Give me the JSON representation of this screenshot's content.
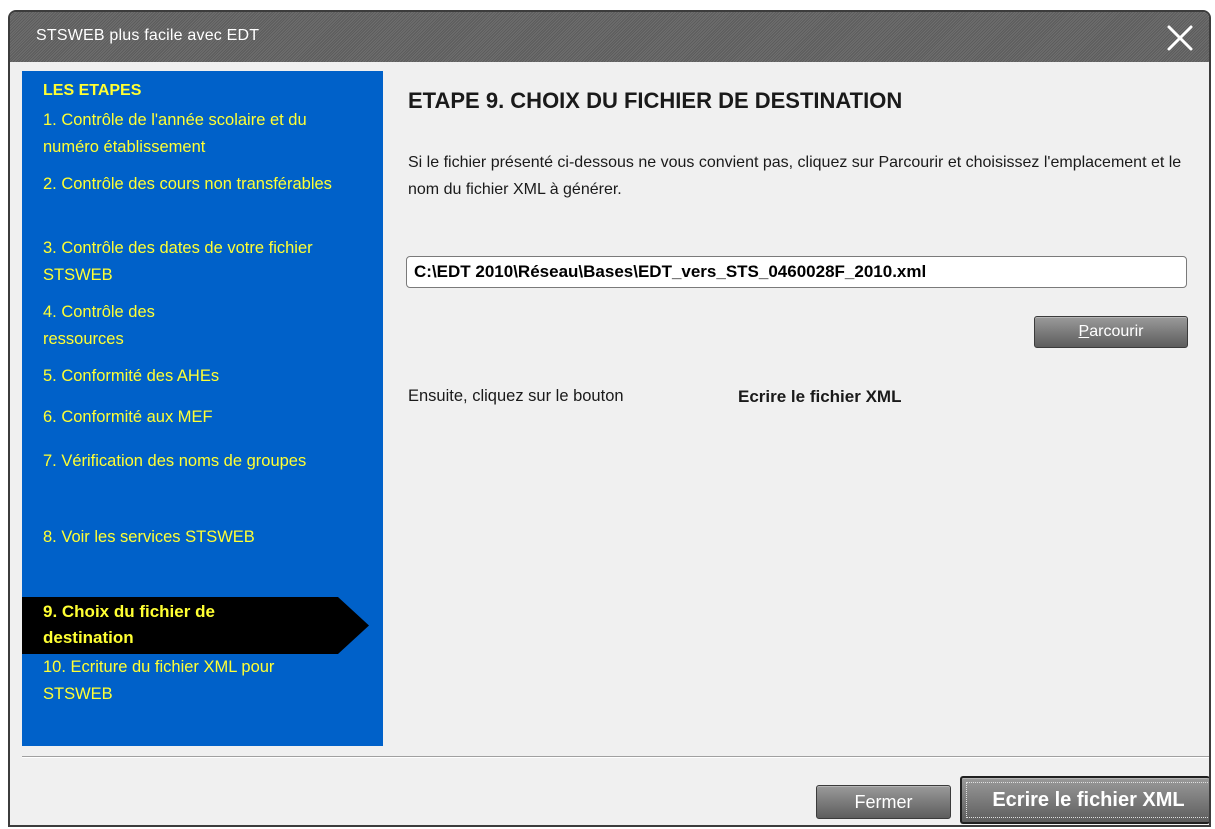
{
  "window": {
    "title": "STSWEB plus facile avec EDT"
  },
  "sidebar": {
    "header": "LES ETAPES",
    "steps": [
      {
        "label": "1. Contrôle de l'année scolaire et du numéro établissement"
      },
      {
        "label": "2. Contrôle des cours non transférables"
      },
      {
        "label": "3. Contrôle des dates de votre fichier STSWEB"
      },
      {
        "label": "4. Contrôle des ressources"
      },
      {
        "label": "5. Conformité des AHEs"
      },
      {
        "label": "6. Conformité aux MEF"
      },
      {
        "label": "7. Vérification des noms de groupes"
      },
      {
        "label": "8. Voir les services STSWEB"
      },
      {
        "label": "9. Choix du fichier  de destination",
        "active": true
      },
      {
        "label": "10. Ecriture du fichier XML pour STSWEB"
      }
    ]
  },
  "main": {
    "title": "ETAPE 9. CHOIX DU FICHIER DE DESTINATION",
    "instruction": "Si le fichier présenté ci-dessous ne vous convient pas, cliquez sur Parcourir et choisissez l'emplacement et le nom du fichier XML à générer.",
    "file_path": "C:\\EDT 2010\\Réseau\\Bases\\EDT_vers_STS_0460028F_2010.xml",
    "browse_mnemonic": "P",
    "browse_rest": "arcourir",
    "next_label": "Ensuite, cliquez sur le bouton",
    "next_action": "Ecrire le fichier XML"
  },
  "footer": {
    "close_label": "Fermer",
    "write_label": "Ecrire le fichier XML"
  },
  "colors": {
    "sidebar_bg": "#0061c9",
    "sidebar_text": "#ffff33",
    "active_step_bg": "#000000"
  },
  "icons": {
    "close": "close-x-icon"
  }
}
